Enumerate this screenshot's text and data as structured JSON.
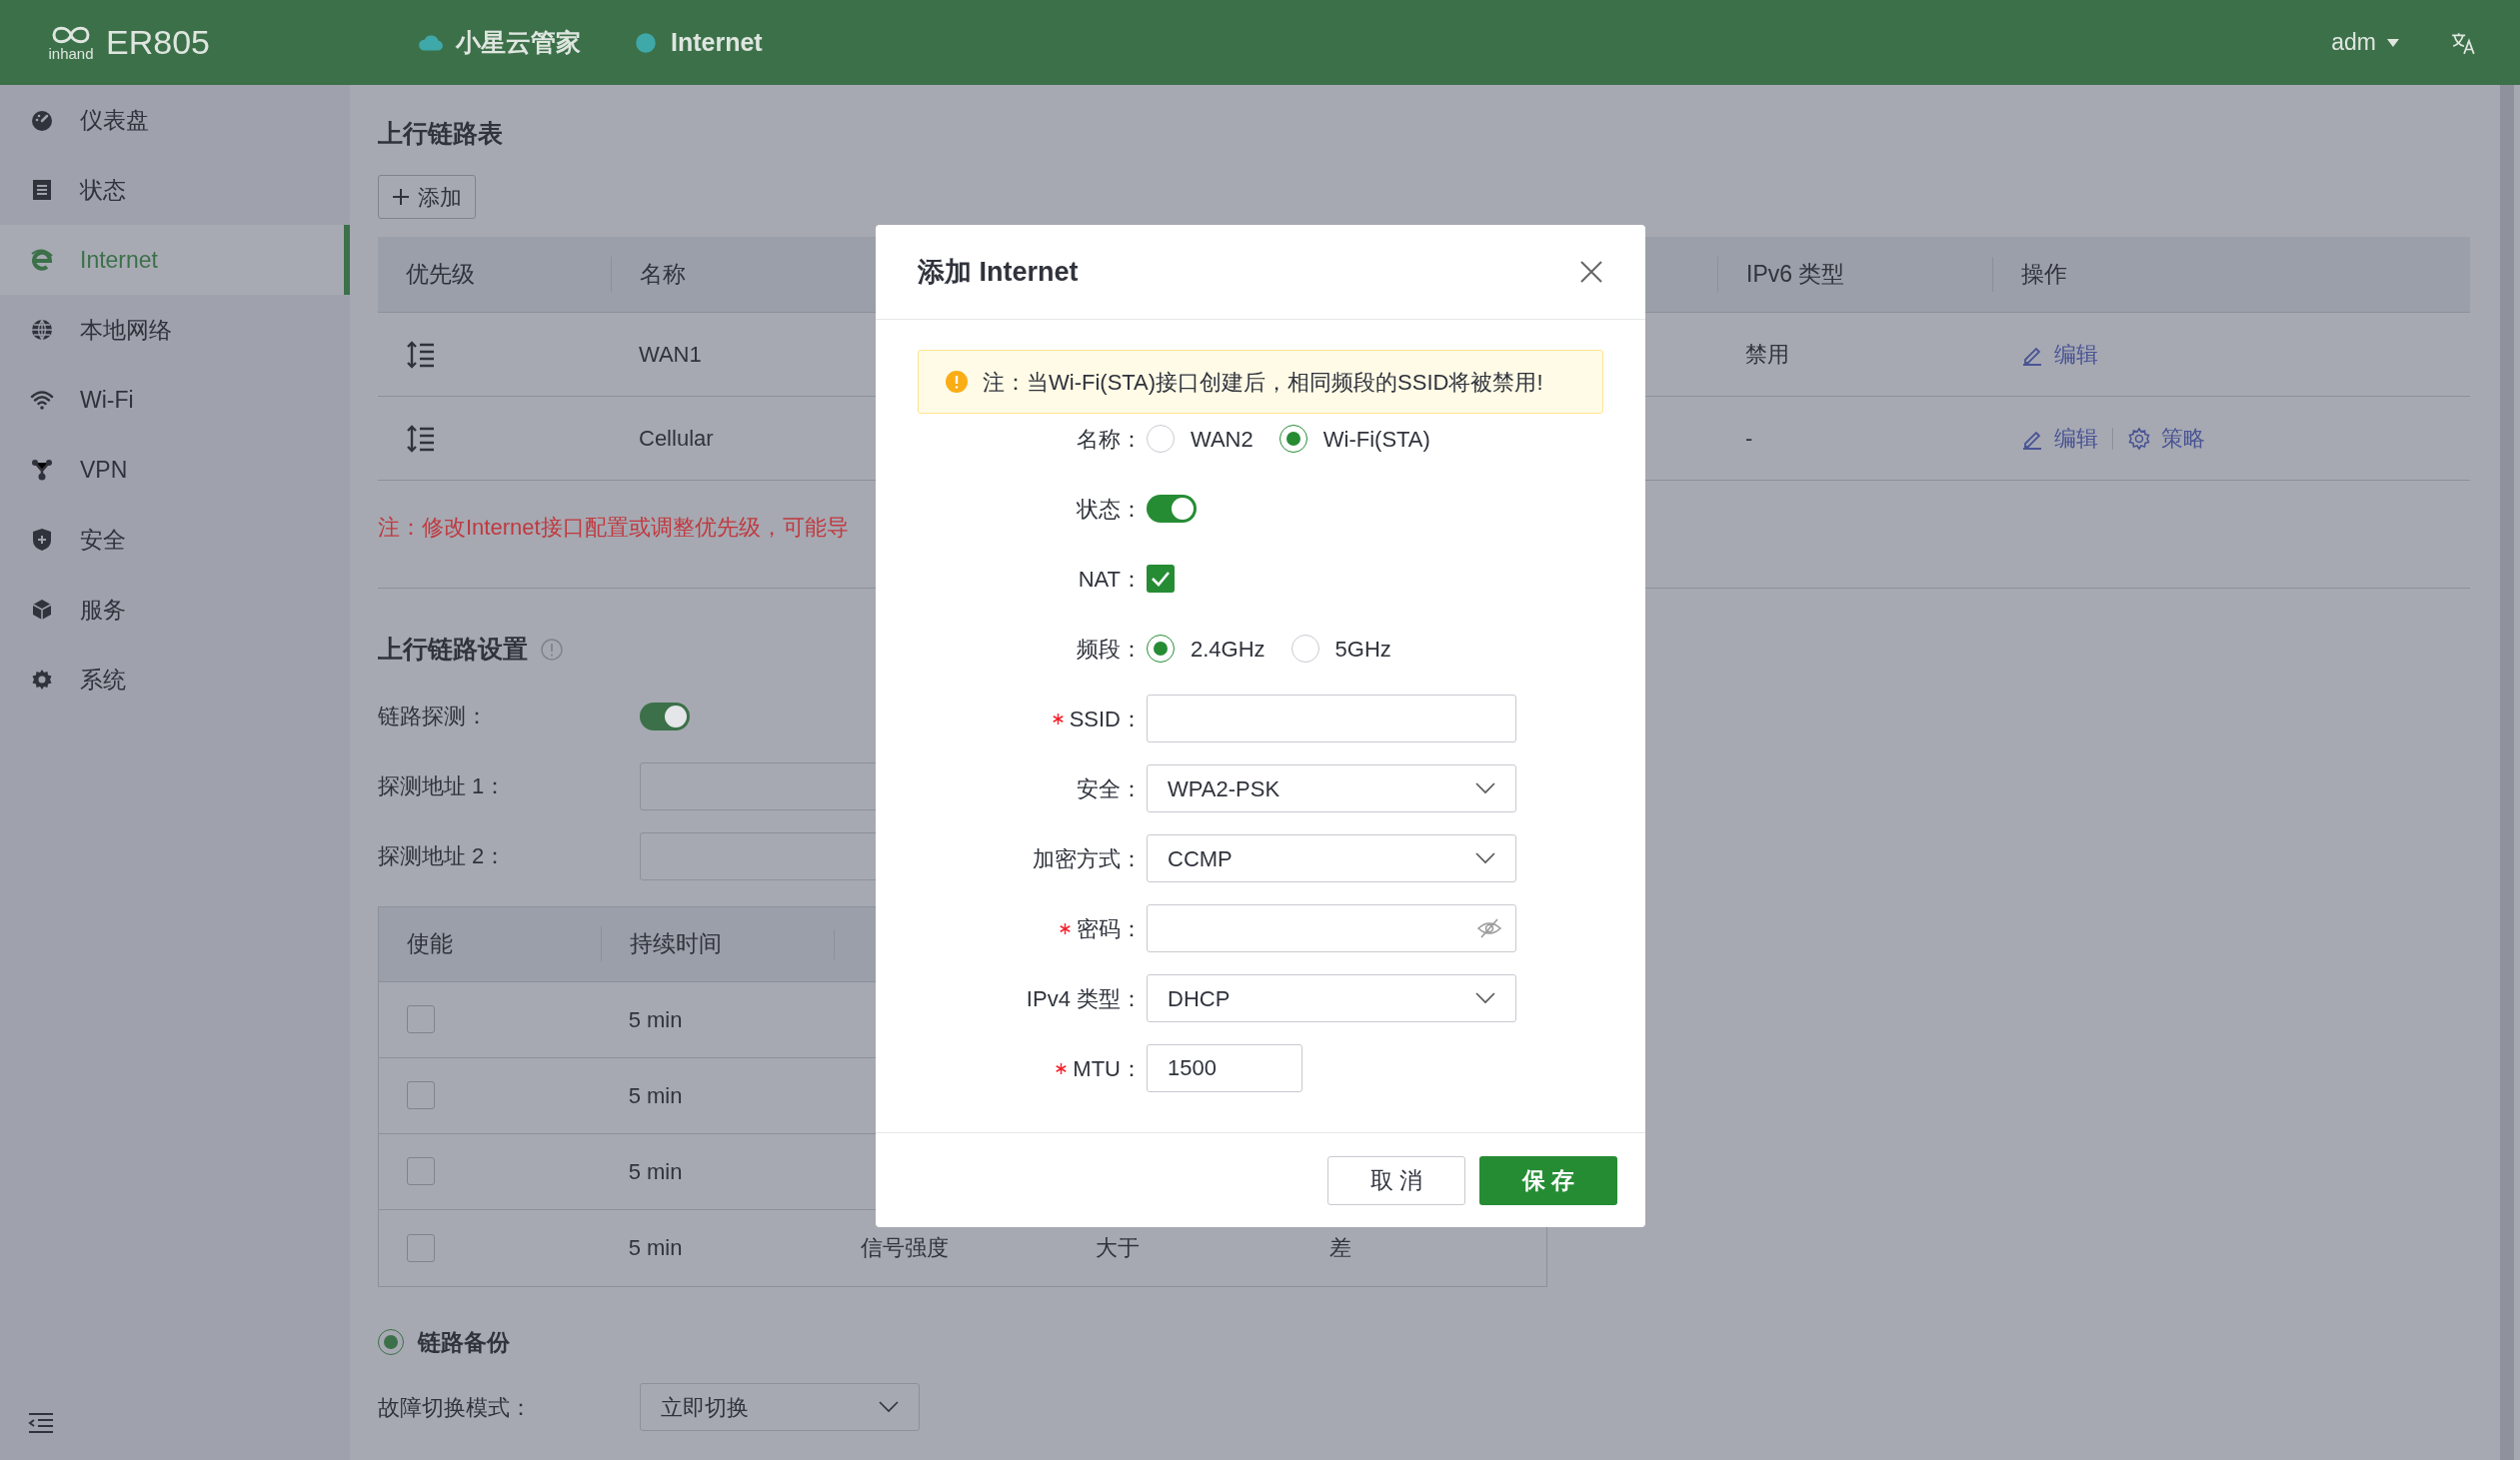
{
  "header": {
    "logo_mark": "inhand",
    "product": "ER805",
    "nav": [
      {
        "label": "小星云管家",
        "kind": "cloud"
      },
      {
        "label": "Internet",
        "kind": "dot"
      }
    ],
    "user": "adm"
  },
  "sidebar": {
    "items": [
      {
        "label": "仪表盘",
        "selected": false
      },
      {
        "label": "状态",
        "selected": false
      },
      {
        "label": "Internet",
        "selected": true
      },
      {
        "label": "本地网络",
        "selected": false
      },
      {
        "label": "Wi-Fi",
        "selected": false
      },
      {
        "label": "VPN",
        "selected": false
      },
      {
        "label": "安全",
        "selected": false
      },
      {
        "label": "服务",
        "selected": false
      },
      {
        "label": "系统",
        "selected": false
      }
    ]
  },
  "uplink_table": {
    "title": "上行链路表",
    "add_button": "添加",
    "columns": [
      "优先级",
      "名称",
      "IPv6 类型",
      "操作"
    ],
    "rows": [
      {
        "name": "WAN1",
        "ipv6": "禁用",
        "actions": [
          {
            "label": "编辑",
            "kind": "edit"
          }
        ]
      },
      {
        "name": "Cellular",
        "ipv6": "-",
        "actions": [
          {
            "label": "编辑",
            "kind": "edit"
          },
          {
            "label": "策略",
            "kind": "policy"
          }
        ]
      }
    ],
    "note": "注：修改Internet接口配置或调整优先级，可能导"
  },
  "uplink_settings": {
    "title": "上行链路设置",
    "link_detection": {
      "label": "链路探测：",
      "on": true
    },
    "probe_addresses": [
      {
        "label": "探测地址 1："
      },
      {
        "label": "探测地址 2："
      }
    ],
    "table": {
      "columns": [
        "使能",
        "持续时间"
      ],
      "rows": [
        {
          "checked": false,
          "duration": "5 min"
        },
        {
          "checked": false,
          "duration": "5 min"
        },
        {
          "checked": false,
          "duration": "5 min"
        },
        {
          "checked": false,
          "duration": "5 min",
          "column_3": "信号强度",
          "column_4": "大于",
          "column_5": "差"
        }
      ]
    },
    "backup": {
      "label": "链路备份",
      "selected": true
    },
    "failover": {
      "label": "故障切换模式：",
      "value": "立即切换"
    }
  },
  "modal": {
    "title": "添加 Internet",
    "alert": "注：当Wi-Fi(STA)接口创建后，相同频段的SSID将被禁用!",
    "fields": [
      {
        "kind": "radio",
        "label": "名称：",
        "options": [
          {
            "label": "WAN2",
            "selected": false
          },
          {
            "label": "Wi-Fi(STA)",
            "selected": true
          }
        ]
      },
      {
        "kind": "toggle",
        "label": "状态：",
        "on": true
      },
      {
        "kind": "checkbox",
        "label": "NAT：",
        "checked": true
      },
      {
        "kind": "radio",
        "label": "频段：",
        "options": [
          {
            "label": "2.4GHz",
            "selected": true
          },
          {
            "label": "5GHz",
            "selected": false
          }
        ]
      },
      {
        "kind": "text",
        "label": "SSID：",
        "required": true
      },
      {
        "kind": "select",
        "label": "安全：",
        "value": "WPA2-PSK"
      },
      {
        "kind": "select",
        "label": "加密方式：",
        "value": "CCMP"
      },
      {
        "kind": "password",
        "label": "密码：",
        "required": true
      },
      {
        "kind": "select",
        "label": "IPv4 类型：",
        "value": "DHCP"
      },
      {
        "kind": "short_text",
        "label": "MTU：",
        "required": true,
        "value": "1500"
      }
    ],
    "buttons": [
      {
        "label": "取 消",
        "kind": "secondary"
      },
      {
        "label": "保 存",
        "kind": "primary"
      }
    ]
  }
}
